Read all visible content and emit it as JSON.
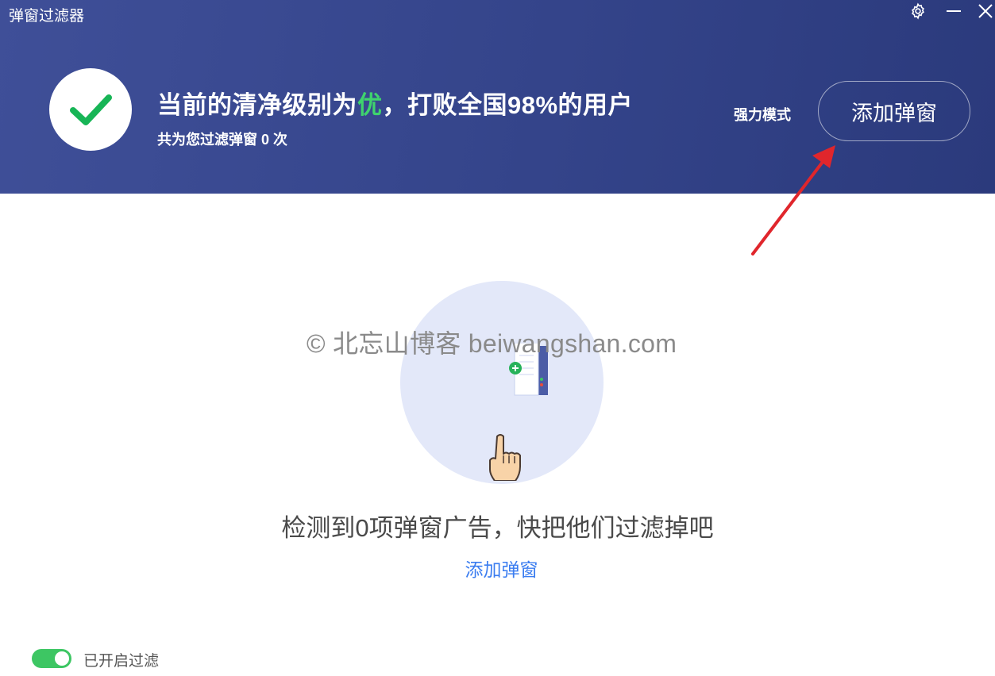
{
  "window": {
    "title": "弹窗过滤器",
    "controls": {
      "settings_icon": "gear-icon",
      "minimize_icon": "minimize-icon",
      "close_icon": "close-icon"
    }
  },
  "status": {
    "prefix": "当前的清净级别为",
    "grade": "优",
    "suffix": "，打败全国98%的用户",
    "filter_count_prefix": "共为您过滤弹窗",
    "filter_count_value": "0",
    "filter_count_suffix": "次"
  },
  "header": {
    "strong_mode_label": "强力模式",
    "add_popup_button": "添加弹窗"
  },
  "main": {
    "watermark": "© 北忘山博客 beiwangshan.com",
    "empty_message": "检测到0项弹窗广告，快把他们过滤掉吧",
    "add_popup_link": "添加弹窗"
  },
  "footer": {
    "toggle_label": "已开启过滤",
    "toggle_on": true
  },
  "colors": {
    "header": "#3a4a8f",
    "grade_green": "#3fd36d",
    "link_blue": "#3b7df0",
    "toggle_green": "#3dc663",
    "arrow_red": "#e0262c"
  }
}
